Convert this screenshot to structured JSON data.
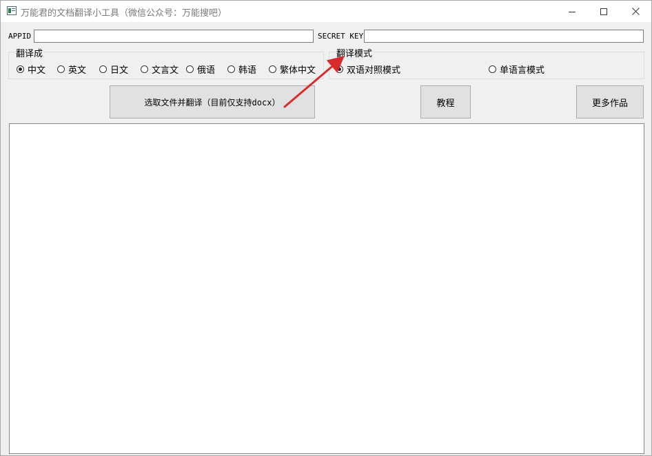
{
  "window": {
    "title": "万能君的文档翻译小工具（微信公众号：万能搜吧）"
  },
  "credentials": {
    "appid_label": "APPID",
    "appid_value": "",
    "secret_label": "SECRET KEY",
    "secret_value": ""
  },
  "target_language": {
    "title": "翻译成",
    "options": [
      "中文",
      "英文",
      "日文",
      "文言文",
      "俄语",
      "韩语",
      "繁体中文"
    ],
    "selected": "中文"
  },
  "mode": {
    "title": "翻译模式",
    "options": [
      "双语对照模式",
      "单语言模式"
    ],
    "selected": "双语对照模式"
  },
  "buttons": {
    "select_file": "选取文件并翻译（目前仅支持docx）",
    "tutorial": "教程",
    "more": "更多作品"
  },
  "output": {
    "text": ""
  },
  "colors": {
    "arrow": "#d92b2b",
    "button_bg": "#e1e1e1"
  }
}
